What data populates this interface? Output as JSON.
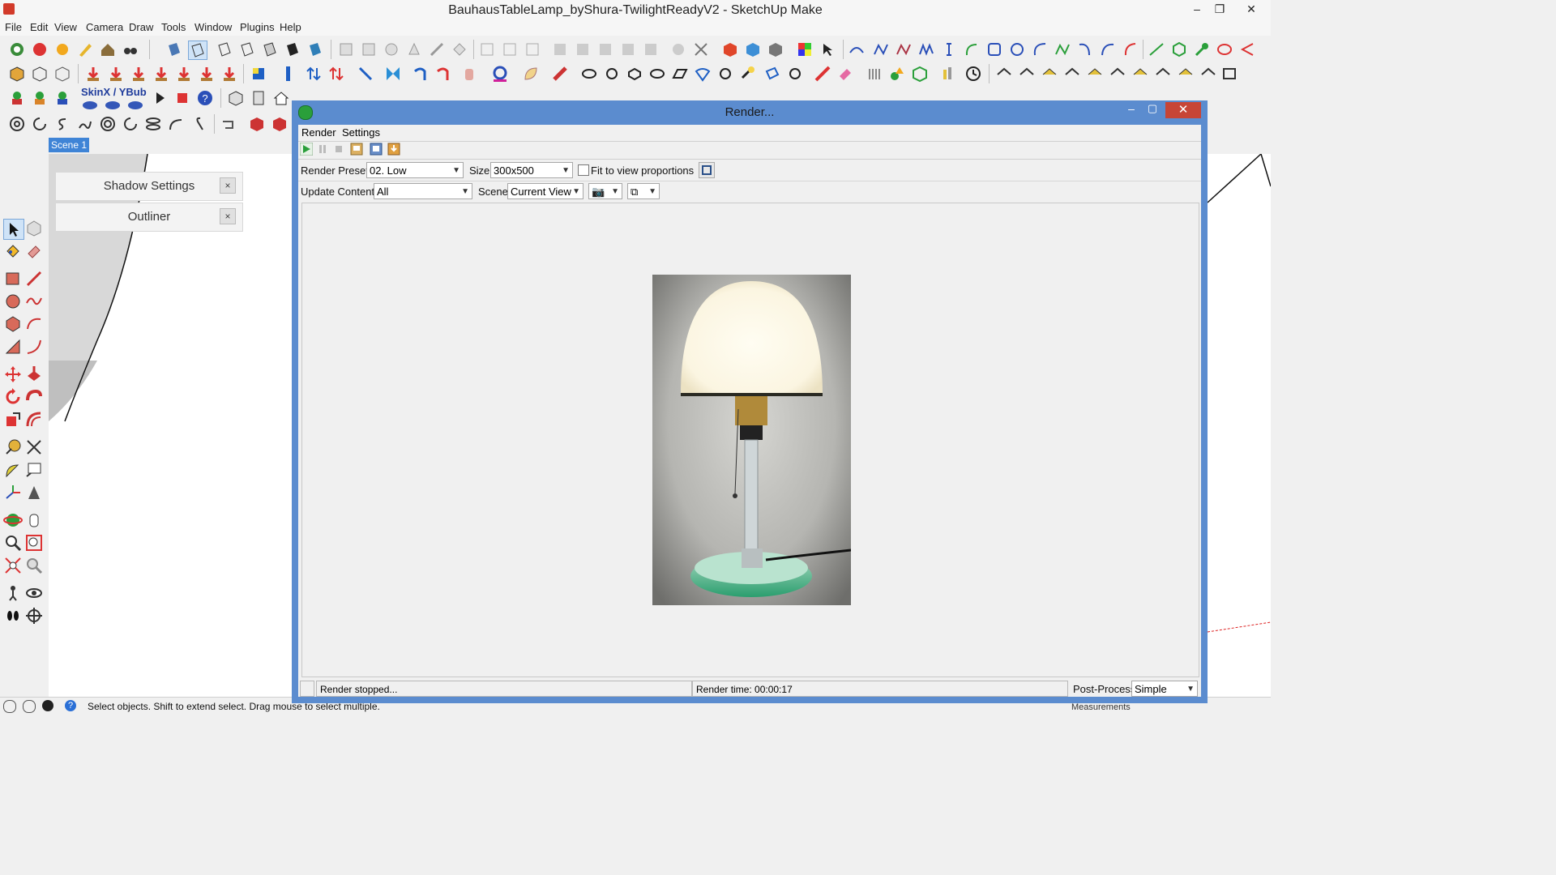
{
  "app": {
    "title": "BauhausTableLamp_byShura-TwilightReadyV2 - SketchUp Make"
  },
  "menubar": {
    "items": [
      "File",
      "Edit",
      "View",
      "Camera",
      "Draw",
      "Tools",
      "Window",
      "Plugins",
      "Help"
    ]
  },
  "toolbar": {
    "skinx_label": "SkinX / YBub"
  },
  "scene_tab": {
    "label": "Scene 1"
  },
  "tray": {
    "shadow_settings": "Shadow Settings",
    "outliner": "Outliner",
    "close_glyph": "×"
  },
  "render_window": {
    "title": "Render...",
    "menu": [
      "Render",
      "Settings"
    ],
    "render_preset_label": "Render Preset:",
    "render_preset_value": "02. Low",
    "size_label": "Size:",
    "size_value": "300x500",
    "fit_checkbox_label": "Fit to view proportions",
    "fit_checked": false,
    "update_content_label": "Update Content:",
    "update_content_value": "All",
    "scene_label": "Scene:",
    "scene_value": "Current View",
    "status_text": "Render stopped...",
    "render_time": "Render time: 00:00:17",
    "post_process_label": "Post-Process:",
    "post_process_value": "Simple"
  },
  "statusbar": {
    "text": "Select objects. Shift to extend select. Drag mouse to select multiple.",
    "measurements_label": "Measurements"
  },
  "colors": {
    "window_frame": "#5b8ccf",
    "close_button": "#c74536",
    "scene_tab": "#3f84d6"
  },
  "icons": [
    "play-icon",
    "pause-icon",
    "stop-icon",
    "save-image-icon",
    "copy-image-icon",
    "export-icon",
    "camera-icon",
    "copy-icon"
  ]
}
